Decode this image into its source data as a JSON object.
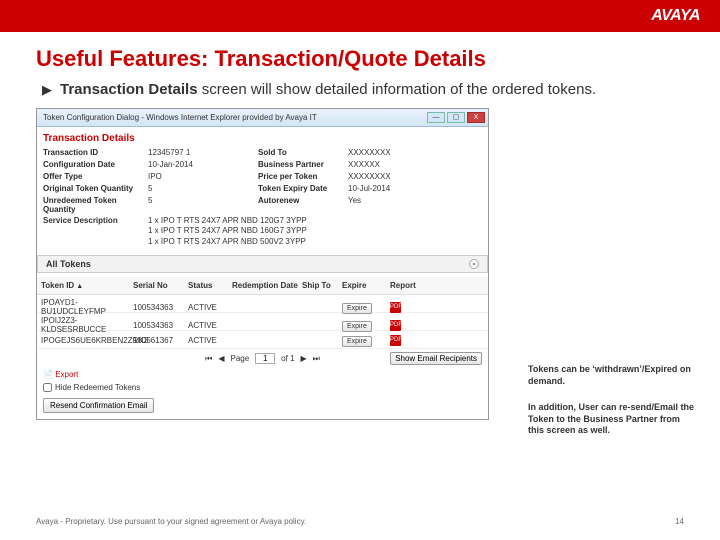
{
  "brand": "AVAYA",
  "slide": {
    "title": "Useful Features: Transaction/Quote Details",
    "bullet_prefix_bold": "Transaction Details",
    "bullet_rest": " screen will show detailed information of the ordered tokens."
  },
  "window": {
    "title": "Token Configuration Dialog - Windows Internet Explorer provided by Avaya IT",
    "min": "—",
    "max": "▢",
    "close": "X"
  },
  "panel_heading": "Transaction Details",
  "details": {
    "transaction_id": {
      "label": "Transaction ID",
      "value": "12345797 1"
    },
    "configuration_date": {
      "label": "Configuration Date",
      "value": "10-Jan-2014"
    },
    "offer_type": {
      "label": "Offer Type",
      "value": "IPO"
    },
    "original_token_qty": {
      "label": "Original Token Quantity",
      "value": "5"
    },
    "unredeemed_token_qty": {
      "label": "Unredeemed Token Quantity",
      "value": "5"
    },
    "sold_to": {
      "label": "Sold To",
      "value": "XXXXXXXX"
    },
    "business_partner": {
      "label": "Business Partner",
      "value": "XXXXXX"
    },
    "price_per_token": {
      "label": "Price per Token",
      "value": "XXXXXXXX"
    },
    "token_expiry_date": {
      "label": "Token Expiry Date",
      "value": "10-Jul-2014"
    },
    "autorenew": {
      "label": "Autorenew",
      "value": "Yes"
    }
  },
  "service_desc": {
    "label": "Service Description",
    "lines": [
      "1 x IPO T RTS 24X7 APR NBD 120G7 3YPP",
      "1 x IPO T RTS 24X7 APR NBD 160G7 3YPP",
      "1 x IPO T RTS 24X7 APR NBD 500V2 3YPP"
    ]
  },
  "all_tokens_heading": "All Tokens",
  "table": {
    "headers": [
      "Token ID",
      "Serial No",
      "Status",
      "Redemption Date",
      "Ship To",
      "Expire",
      "Report"
    ],
    "rows": [
      {
        "id": "IPOAYD1-BU1UDCLEYFMP",
        "serial": "100534363",
        "status": "ACTIVE"
      },
      {
        "id": "IPOIJ2Z3-KLDSESRBUCCE",
        "serial": "100534363",
        "status": "ACTIVE"
      },
      {
        "id": "IPOGEJS6UE6KRBEN2ZRK3",
        "serial": "100561367",
        "status": "ACTIVE"
      }
    ],
    "expire_label": "Expire",
    "pdf_label": "PDF"
  },
  "pager": {
    "page": "Page",
    "value": "1",
    "of": "of 1",
    "show_recip": "Show Email Recipients"
  },
  "export_label": "Export",
  "hide_redeemed_label": "Hide Redeemed Tokens",
  "resend_label": "Resend Confirmation Email",
  "callouts": {
    "c1": "Tokens can be ‘withdrawn’/Expired on demand.",
    "c2": "In addition,  User can re-send/Email the Token to the Business Partner from this screen as well."
  },
  "footer": {
    "left": "Avaya - Proprietary.  Use pursuant to your signed agreement or Avaya policy.",
    "right": "14"
  }
}
